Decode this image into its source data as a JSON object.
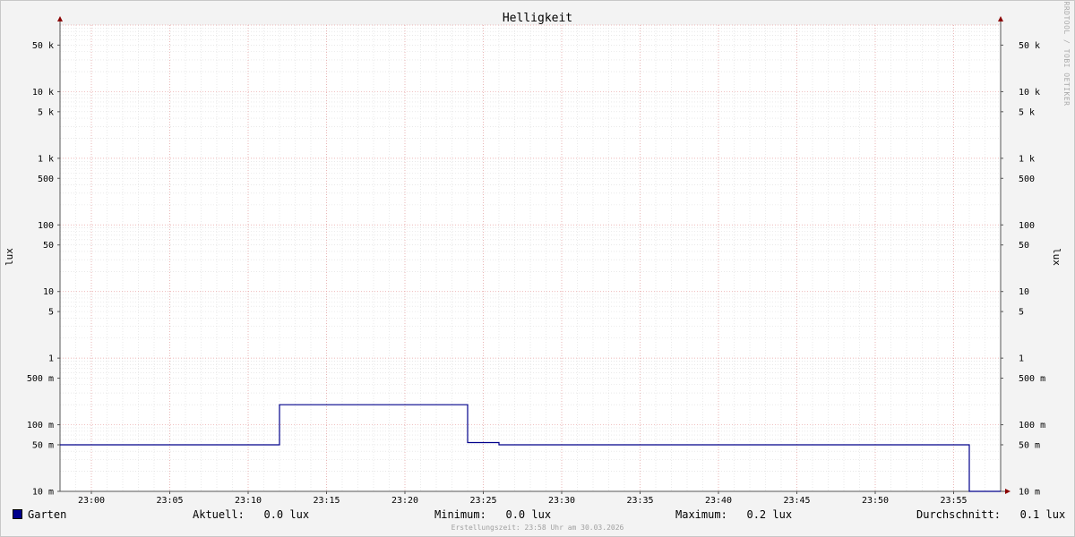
{
  "chart_data": {
    "type": "line",
    "title": "Helligkeit",
    "ylabel": "lux",
    "yscale": "log",
    "ylim": [
      0.01,
      100000
    ],
    "xlim": [
      "22:58",
      "23:58"
    ],
    "x_ticks": [
      "23:00",
      "23:05",
      "23:10",
      "23:15",
      "23:20",
      "23:25",
      "23:30",
      "23:35",
      "23:40",
      "23:45",
      "23:50",
      "23:55"
    ],
    "y_ticks": [
      {
        "value": 0.01,
        "label": "10 m"
      },
      {
        "value": 0.05,
        "label": "50 m"
      },
      {
        "value": 0.1,
        "label": "100 m"
      },
      {
        "value": 0.5,
        "label": "500 m"
      },
      {
        "value": 1,
        "label": "1"
      },
      {
        "value": 5,
        "label": "5"
      },
      {
        "value": 10,
        "label": "10"
      },
      {
        "value": 50,
        "label": "50"
      },
      {
        "value": 100,
        "label": "100"
      },
      {
        "value": 500,
        "label": "500"
      },
      {
        "value": 1000,
        "label": "1 k"
      },
      {
        "value": 5000,
        "label": "5 k"
      },
      {
        "value": 10000,
        "label": "10 k"
      },
      {
        "value": 50000,
        "label": "50 k"
      }
    ],
    "grid": true,
    "series": [
      {
        "name": "Garten",
        "color": "#00008b",
        "points": [
          {
            "x": "22:58",
            "y": 0.05
          },
          {
            "x": "23:12",
            "y": 0.05
          },
          {
            "x": "23:12",
            "y": 0.2
          },
          {
            "x": "23:24",
            "y": 0.2
          },
          {
            "x": "23:24",
            "y": 0.054
          },
          {
            "x": "23:26",
            "y": 0.054
          },
          {
            "x": "23:26",
            "y": 0.05
          },
          {
            "x": "23:56",
            "y": 0.05
          },
          {
            "x": "23:56",
            "y": 0.01
          },
          {
            "x": "23:58",
            "y": 0.01
          }
        ]
      }
    ],
    "legend": "bottom"
  },
  "legend": {
    "series_name": "Garten",
    "current_label": "Aktuell:",
    "current_value": "0.0 lux",
    "min_label": "Minimum:",
    "min_value": "0.0 lux",
    "max_label": "Maximum:",
    "max_value": "0.2 lux",
    "avg_label": "Durchschnitt:",
    "avg_value": "0.1 lux"
  },
  "watermark": "RRDTOOL / TOBI OETIKER",
  "footer": "Erstellungszeit: 23:58 Uhr am 30.03.2026"
}
